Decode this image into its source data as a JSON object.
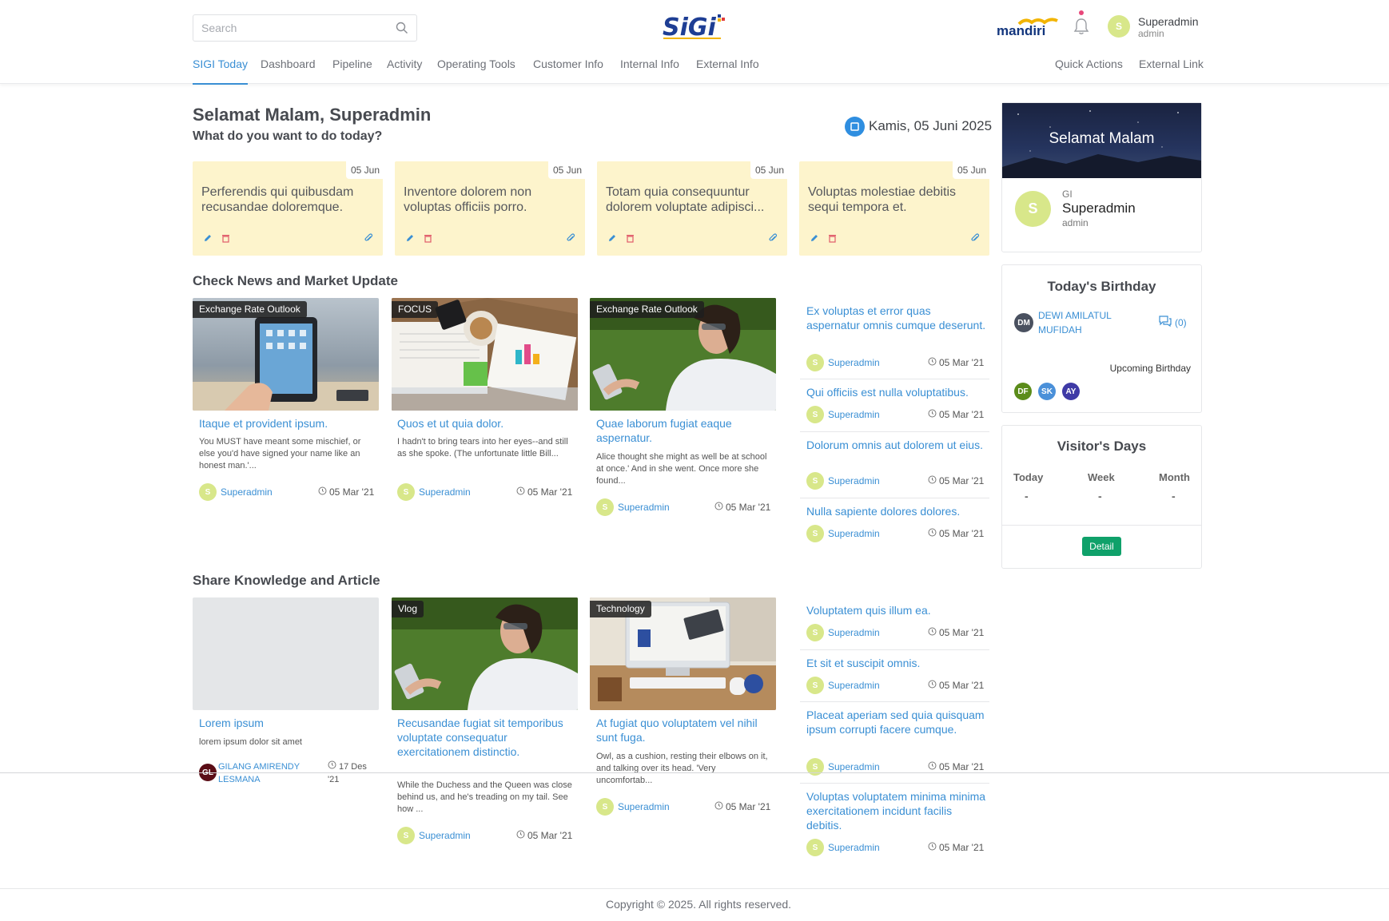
{
  "header": {
    "search_placeholder": "Search",
    "nav": [
      "SIGI Today",
      "Dashboard",
      "Pipeline",
      "Activity",
      "Operating Tools",
      "Customer Info",
      "Internal Info",
      "External Info"
    ],
    "nav_right": [
      "Quick Actions",
      "External Link"
    ],
    "user": {
      "name": "Superadmin",
      "role": "admin",
      "initial": "S"
    },
    "bank_logo_text": "mandiri",
    "accent": "#3a8fd4"
  },
  "greeting": {
    "title": "Selamat Malam, Superadmin",
    "subtitle": "What do you want to do today?",
    "date": "Kamis, 05 Juni 2025"
  },
  "notes": [
    {
      "date": "05 Jun",
      "text": "Perferendis qui quibusdam recusandae doloremque."
    },
    {
      "date": "05 Jun",
      "text": "Inventore dolorem non voluptas officiis porro."
    },
    {
      "date": "05 Jun",
      "text": "Totam quia consequuntur dolorem voluptate adipisci..."
    },
    {
      "date": "05 Jun",
      "text": "Voluptas molestiae debitis sequi tempora et."
    }
  ],
  "news": {
    "title": "Check News and Market Update",
    "cards": [
      {
        "tag": "Exchange Rate Outlook",
        "title": "Itaque et provident ipsum.",
        "desc": "You MUST have meant some mischief, or else you'd have signed your name like an honest man.'...",
        "author": "Superadmin",
        "date": "05 Mar '21"
      },
      {
        "tag": "FOCUS",
        "title": "Quos et ut quia dolor.",
        "desc": "I hadn't to bring tears into her eyes--and still as she spoke. (The unfortunate little Bill...",
        "author": "Superadmin",
        "date": "05 Mar '21"
      },
      {
        "tag": "Exchange Rate Outlook",
        "title": "Quae laborum fugiat eaque aspernatur.",
        "desc": "Alice thought she might as well be at school at once.' And in she went. Once more she found...",
        "author": "Superadmin",
        "date": "05 Mar '21"
      }
    ],
    "list": [
      {
        "title": "Ex voluptas et error quas aspernatur omnis cumque deserunt.",
        "author": "Superadmin",
        "date": "05 Mar '21"
      },
      {
        "title": "Qui officiis est nulla voluptatibus.",
        "author": "Superadmin",
        "date": "05 Mar '21"
      },
      {
        "title": "Dolorum omnis aut dolorem ut eius.",
        "author": "Superadmin",
        "date": "05 Mar '21"
      },
      {
        "title": "Nulla sapiente dolores dolores.",
        "author": "Superadmin",
        "date": "05 Mar '21"
      }
    ]
  },
  "knowledge": {
    "title": "Share Knowledge and Article",
    "cards": [
      {
        "tag": "",
        "title": "Lorem ipsum",
        "desc": "lorem ipsum dolor sit amet",
        "author_line1": "GILANG AMIRENDY",
        "author_line2": "LESMANA",
        "author_initials": "GL",
        "date_line1": "17 Des",
        "date_line2": "'21"
      },
      {
        "tag": "Vlog",
        "title": "Recusandae fugiat sit temporibus voluptate consequatur exercitationem distinctio.",
        "desc": "While the Duchess and the Queen was close behind us, and he's treading on my tail. See how ...",
        "author": "Superadmin",
        "date": "05 Mar '21"
      },
      {
        "tag": "Technology",
        "title": "At fugiat quo voluptatem vel nihil sunt fuga.",
        "desc": "Owl, as a cushion, resting their elbows on it, and talking over its head. 'Very uncomfortab...",
        "author": "Superadmin",
        "date": "05 Mar '21"
      }
    ],
    "list": [
      {
        "title": "Voluptatem quis illum ea.",
        "author": "Superadmin",
        "date": "05 Mar '21"
      },
      {
        "title": "Et sit et suscipit omnis.",
        "author": "Superadmin",
        "date": "05 Mar '21"
      },
      {
        "title": "Placeat aperiam sed quia quisquam ipsum corrupti facere cumque.",
        "author": "Superadmin",
        "date": "05 Mar '21"
      },
      {
        "title": "Voluptas voluptatem minima minima exercitationem incidunt facilis debitis.",
        "author": "Superadmin",
        "date": "05 Mar '21"
      }
    ]
  },
  "profile_card": {
    "banner": "Selamat Malam",
    "group": "GI",
    "name": "Superadmin",
    "role": "admin",
    "initial": "S"
  },
  "birthday": {
    "title": "Today's Birthday",
    "today": {
      "initials": "DM",
      "name_line1": "DEWI AMILATUL",
      "name_line2": "MUFIDAH",
      "comments": "(0)"
    },
    "upcoming_label": "Upcoming Birthday",
    "upcoming": [
      {
        "initials": "DF",
        "color": "#5b8c1a"
      },
      {
        "initials": "SK",
        "color": "#4a90d9"
      },
      {
        "initials": "AY",
        "color": "#3f3aa6"
      }
    ]
  },
  "visitors": {
    "title": "Visitor's Days",
    "cols": [
      {
        "label": "Today",
        "value": "-"
      },
      {
        "label": "Week",
        "value": "-"
      },
      {
        "label": "Month",
        "value": "-"
      }
    ],
    "button": "Detail"
  },
  "footer": {
    "copyright": "Copyright © 2025. All rights reserved."
  }
}
